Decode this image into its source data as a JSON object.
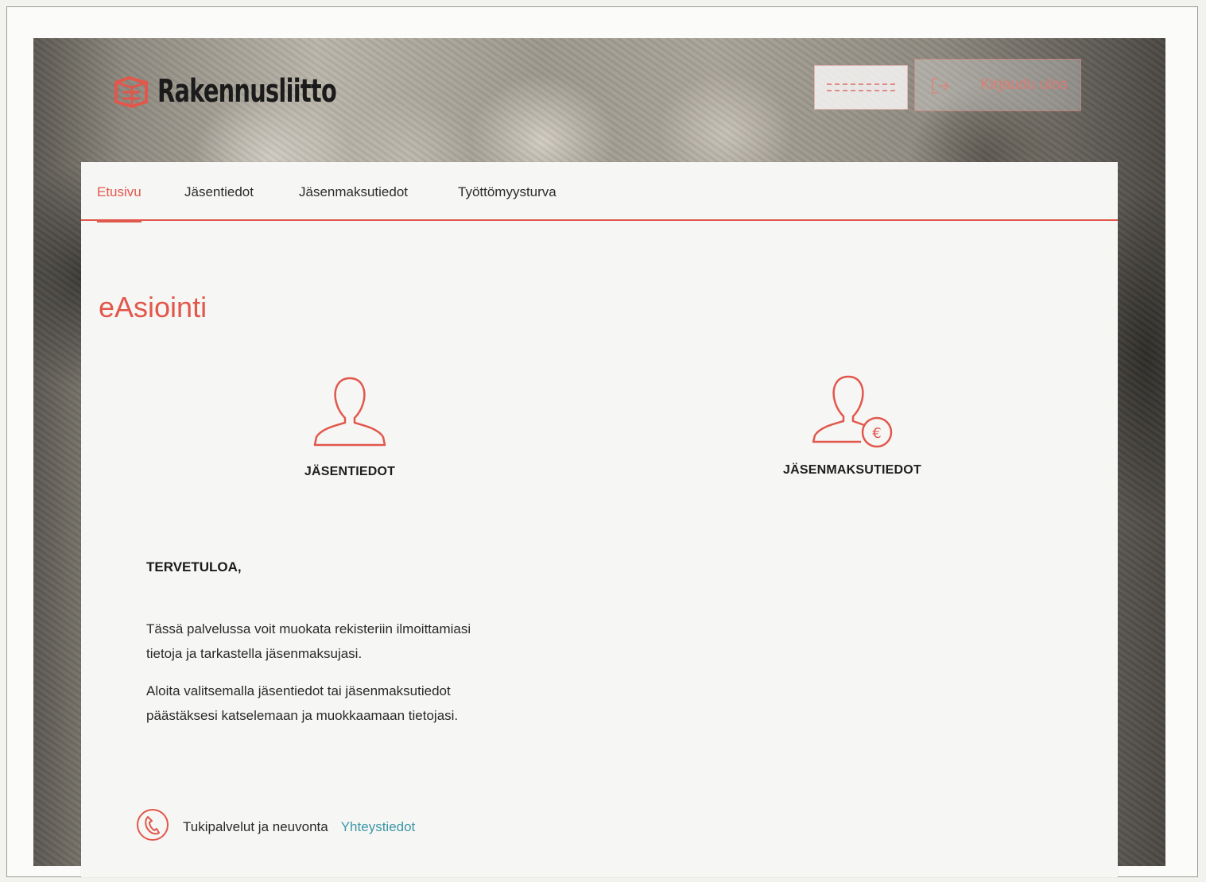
{
  "header": {
    "logo_text": "Rakennusliitto",
    "logout_label": "Kirjaudu ulos",
    "accent_color": "#e2574c"
  },
  "nav": {
    "tabs": [
      {
        "label": "Etusivu",
        "active": true
      },
      {
        "label": "Jäsentiedot",
        "active": false
      },
      {
        "label": "Jäsenmaksutiedot",
        "active": false
      },
      {
        "label": "Työttömyysturva",
        "active": false
      }
    ]
  },
  "main": {
    "title": "eAsiointi",
    "tiles": [
      {
        "label": "JÄSENTIEDOT",
        "icon": "person-icon"
      },
      {
        "label": "JÄSENMAKSUTIEDOT",
        "icon": "person-euro-icon"
      }
    ],
    "welcome": {
      "heading": "TERVETULOA,",
      "paragraph1_line1": "Tässä palvelussa voit muokata rekisteriin ilmoittamiasi",
      "paragraph1_line2": "tietoja ja tarkastella jäsenmaksujasi.",
      "paragraph2_line1": "Aloita valitsemalla jäsentiedot tai jäsenmaksutiedot",
      "paragraph2_line2": "päästäksesi katselemaan ja muokkaamaan tietojasi."
    }
  },
  "footer": {
    "support_label": "Tukipalvelut ja neuvonta",
    "contact_link": "Yhteystiedot",
    "link_color": "#3c97a7"
  }
}
